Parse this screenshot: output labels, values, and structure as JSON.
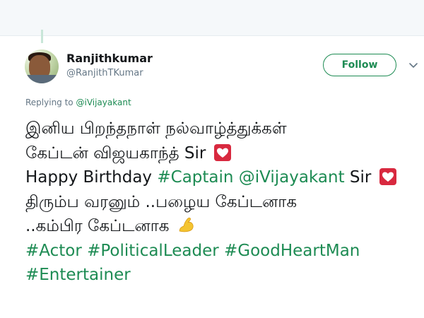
{
  "user": {
    "name": "Ranjithkumar",
    "handle": "@RanjithTKumar"
  },
  "follow_label": "Follow",
  "replying": {
    "prefix": "Replying to",
    "mention": "@iVijayakant"
  },
  "tweet": {
    "line1": "இனிய பிறந்தநாள் நல்வாழ்த்துக்கள்",
    "line2_text": "கேப்டன் விஜயகாந்த் Sir",
    "line3_text": "Happy Birthday",
    "line3_hashtag": "#Captain",
    "line3_mention": "@iVijayakant",
    "line3_suffix": "Sir",
    "line4": "திரும்ப வரனும் ..பழைய கேப்டனாக",
    "line5_text": "..கம்பிர கேப்டனாக",
    "hashtags_line6": [
      "#Actor",
      "#PoliticalLeader",
      "#GoodHeartMan"
    ],
    "hashtags_line7": [
      "#Entertainer"
    ]
  },
  "icons": {
    "heart": "white-heart-icon",
    "arm": "flexed-biceps-icon",
    "more": "chevron-down-icon"
  },
  "colors": {
    "accent": "#1d8b53",
    "heart_bg": "#d8293f",
    "arm": "#f4c430"
  }
}
